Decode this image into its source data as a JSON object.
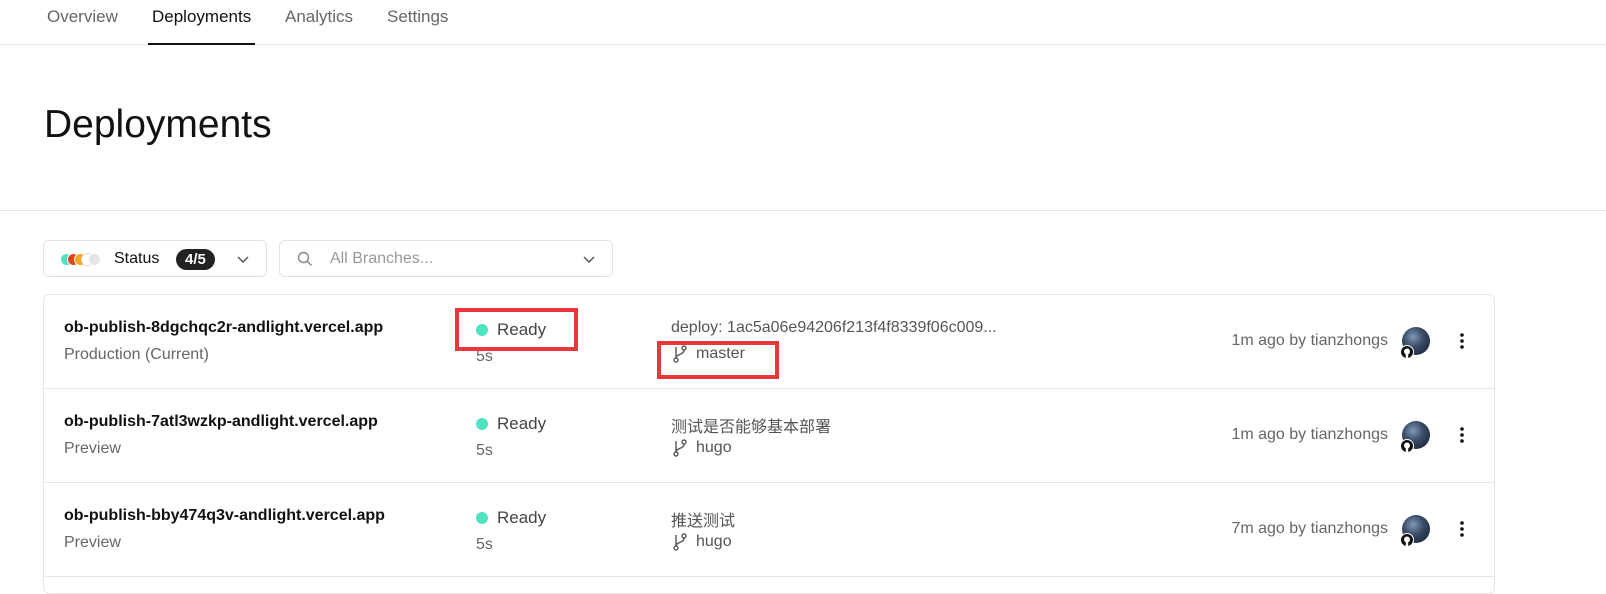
{
  "tabs": [
    "Overview",
    "Deployments",
    "Analytics",
    "Settings"
  ],
  "active_tab": "Deployments",
  "page_title": "Deployments",
  "filters": {
    "status_label": "Status",
    "status_count": "4/5",
    "status_dot_colors": [
      "#50e3c2",
      "#e0441b",
      "#f5a623",
      "#ffffff",
      "#e5e5e5"
    ],
    "branch_placeholder": "All Branches..."
  },
  "colors": {
    "ready": "#50e3c2",
    "highlight": "#e8383b"
  },
  "deployments": [
    {
      "url": "ob-publish-8dgchqc2r-andlight.vercel.app",
      "environment": "Production (Current)",
      "status": "Ready",
      "duration": "5s",
      "commit": "deploy: 1ac5a06e94206f213f4f8339f06c009...",
      "branch": "master",
      "time_by": "1m ago by tianzhongs"
    },
    {
      "url": "ob-publish-7atl3wzkp-andlight.vercel.app",
      "environment": "Preview",
      "status": "Ready",
      "duration": "5s",
      "commit": "测试是否能够基本部署",
      "branch": "hugo",
      "time_by": "1m ago by tianzhongs"
    },
    {
      "url": "ob-publish-bby474q3v-andlight.vercel.app",
      "environment": "Preview",
      "status": "Ready",
      "duration": "5s",
      "commit": "推送测试",
      "branch": "hugo",
      "time_by": "7m ago by tianzhongs"
    }
  ]
}
